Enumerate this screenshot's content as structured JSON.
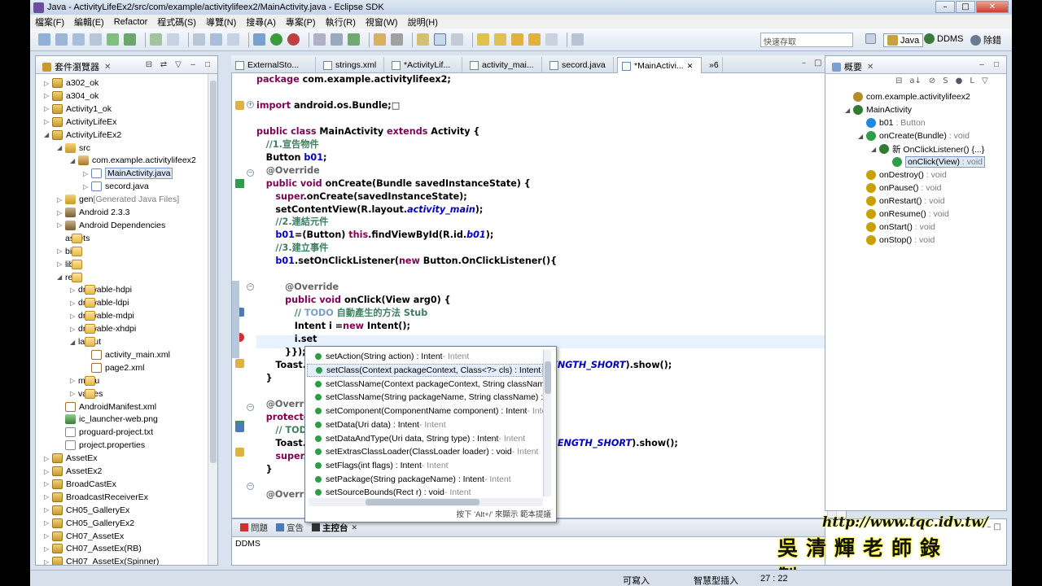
{
  "window": {
    "title": "Java - ActivityLifeEx2/src/com/example/activitylifeex2/MainActivity.java - Eclipse SDK"
  },
  "menu": [
    "檔案(F)",
    "編輯(E)",
    "Refactor",
    "程式碼(S)",
    "導覽(N)",
    "搜尋(A)",
    "專案(P)",
    "執行(R)",
    "視窗(W)",
    "說明(H)"
  ],
  "quick_access": {
    "placeholder": "快速存取"
  },
  "perspectives": {
    "java": "Java",
    "ddms": "DDMS",
    "debug": "除錯"
  },
  "explorer": {
    "title": "套件瀏覽器",
    "items": [
      {
        "label": "a302_ok",
        "depth": 0,
        "icon": "proj",
        "tw": "▷"
      },
      {
        "label": "a304_ok",
        "depth": 0,
        "icon": "proj",
        "tw": "▷"
      },
      {
        "label": "Activity1_ok",
        "depth": 0,
        "icon": "proj",
        "tw": "▷"
      },
      {
        "label": "ActivityLifeEx",
        "depth": 0,
        "icon": "proj",
        "tw": "▷"
      },
      {
        "label": "ActivityLifeEx2",
        "depth": 0,
        "icon": "proj",
        "tw": "◢"
      },
      {
        "label": "src",
        "depth": 1,
        "icon": "src",
        "tw": "◢"
      },
      {
        "label": "com.example.activitylifeex2",
        "depth": 2,
        "icon": "pkg",
        "tw": "◢"
      },
      {
        "label": "MainActivity.java",
        "depth": 3,
        "icon": "java",
        "tw": "▷",
        "selected": true
      },
      {
        "label": "secord.java",
        "depth": 3,
        "icon": "java",
        "tw": "▷"
      },
      {
        "label": "gen",
        "suffix": "[Generated Java Files]",
        "depth": 1,
        "icon": "src",
        "tw": "▷"
      },
      {
        "label": "Android 2.3.3",
        "depth": 1,
        "icon": "lib",
        "tw": "▷"
      },
      {
        "label": "Android Dependencies",
        "depth": 1,
        "icon": "lib",
        "tw": "▷"
      },
      {
        "label": "assets",
        "depth": 1,
        "icon": "fold",
        "tw": ""
      },
      {
        "label": "bin",
        "depth": 1,
        "icon": "fold",
        "tw": "▷"
      },
      {
        "label": "libs",
        "depth": 1,
        "icon": "fold",
        "tw": "▷"
      },
      {
        "label": "res",
        "depth": 1,
        "icon": "fold",
        "tw": "◢"
      },
      {
        "label": "drawable-hdpi",
        "depth": 2,
        "icon": "fold",
        "tw": "▷"
      },
      {
        "label": "drawable-ldpi",
        "depth": 2,
        "icon": "fold",
        "tw": "▷"
      },
      {
        "label": "drawable-mdpi",
        "depth": 2,
        "icon": "fold",
        "tw": "▷"
      },
      {
        "label": "drawable-xhdpi",
        "depth": 2,
        "icon": "fold",
        "tw": "▷"
      },
      {
        "label": "layout",
        "depth": 2,
        "icon": "fold",
        "tw": "◢"
      },
      {
        "label": "activity_main.xml",
        "depth": 3,
        "icon": "xml",
        "tw": ""
      },
      {
        "label": "page2.xml",
        "depth": 3,
        "icon": "xml",
        "tw": ""
      },
      {
        "label": "menu",
        "depth": 2,
        "icon": "fold",
        "tw": "▷"
      },
      {
        "label": "values",
        "depth": 2,
        "icon": "fold",
        "tw": "▷"
      },
      {
        "label": "AndroidManifest.xml",
        "depth": 1,
        "icon": "xml",
        "tw": ""
      },
      {
        "label": "ic_launcher-web.png",
        "depth": 1,
        "icon": "png",
        "tw": ""
      },
      {
        "label": "proguard-project.txt",
        "depth": 1,
        "icon": "file",
        "tw": ""
      },
      {
        "label": "project.properties",
        "depth": 1,
        "icon": "file",
        "tw": ""
      },
      {
        "label": "AssetEx",
        "depth": 0,
        "icon": "proj",
        "tw": "▷"
      },
      {
        "label": "AssetEx2",
        "depth": 0,
        "icon": "proj",
        "tw": "▷"
      },
      {
        "label": "BroadCastEx",
        "depth": 0,
        "icon": "proj",
        "tw": "▷"
      },
      {
        "label": "BroadcastReceiverEx",
        "depth": 0,
        "icon": "proj",
        "tw": "▷"
      },
      {
        "label": "CH05_GalleryEx",
        "depth": 0,
        "icon": "proj",
        "tw": "▷"
      },
      {
        "label": "CH05_GalleryEx2",
        "depth": 0,
        "icon": "proj",
        "tw": "▷"
      },
      {
        "label": "CH07_AssetEx",
        "depth": 0,
        "icon": "proj",
        "tw": "▷"
      },
      {
        "label": "CH07_AssetEx(RB)",
        "depth": 0,
        "icon": "proj",
        "tw": "▷"
      },
      {
        "label": "CH07_AssetEx(Spinner)",
        "depth": 0,
        "icon": "proj",
        "tw": "▷"
      }
    ]
  },
  "editor_tabs": [
    {
      "label": "ExternalSto..."
    },
    {
      "label": "strings.xml"
    },
    {
      "label": "*ActivityLif..."
    },
    {
      "label": "activity_mai..."
    },
    {
      "label": "secord.java"
    },
    {
      "label": "*MainActivi...",
      "active": true
    },
    {
      "label": "»6"
    }
  ],
  "code_lines": [
    {
      "html": "<span class='kw'>package</span> com.example.activitylifeex2;"
    },
    {
      "html": ""
    },
    {
      "html": "<span class='kw'>import</span> android.os.Bundle;&#x25A1;"
    },
    {
      "html": ""
    },
    {
      "html": "<span class='kw'>public class</span> MainActivity <span class='kw'>extends</span> Activity {"
    },
    {
      "html": "   <span class='cm'>//1.宣告物件</span>"
    },
    {
      "html": "   Button <span class='fi' style='font-style:normal'>b01</span>;"
    },
    {
      "html": "   <span class='an'>@Override</span>"
    },
    {
      "html": "   <span class='kw'>public void</span> onCreate(Bundle savedInstanceState) {"
    },
    {
      "html": "      <span class='kw'>super</span>.onCreate(savedInstanceState);"
    },
    {
      "html": "      setContentView(R.layout.<span class='fi'>activity_main</span>);"
    },
    {
      "html": "      <span class='cm'>//2.連結元件</span>"
    },
    {
      "html": "      <span class='fi' style='font-style:normal'>b01</span>=(Button) <span class='kw'>this</span>.findViewById(R.id.<span class='fi'>b01</span>);"
    },
    {
      "html": "      <span class='cm'>//3.建立事件</span>"
    },
    {
      "html": "      <span class='fi' style='font-style:normal'>b01</span>.setOnClickListener(<span class='kw'>new</span> Button.OnClickListener(){"
    },
    {
      "html": ""
    },
    {
      "html": "         <span class='an'>@Override</span>"
    },
    {
      "html": "         <span class='kw'>public void</span> onClick(View arg0) {"
    },
    {
      "html": "            <span class='cm'>// </span><span class='cm' style='color:#7f9fbf'>TODO</span><span class='cm'> 自動產生的方法 Stub</span>"
    },
    {
      "html": "            Intent i =<span class='kw'>new</span> Intent();"
    },
    {
      "html": "            i.set"
    },
    {
      "html": "         }});"
    },
    {
      "html": "      Toast.makeText(MainActivity.<span class='kw'>this</span>, <span style='color:#2a00ff'>\"onCreate\"</span>, Toast.<span class='fi'>LENGTH_SHORT</span>).show();"
    },
    {
      "html": "   }"
    },
    {
      "html": ""
    },
    {
      "html": "   <span class='an'>@Override</span>"
    },
    {
      "html": "   <span class='kw'>protected void</span> onDestroy() {"
    },
    {
      "html": "      <span class='cm'>// TODO 自動產生的方法 Stub</span>"
    },
    {
      "html": "      Toast.makeText(MainActivity.<span class='kw'>this</span>, <span style='color:#2a00ff'>\"onDestroy\"</span>, Toast.<span class='fi'>LENGTH_SHORT</span>).show();"
    },
    {
      "html": "      <span class='kw'>super</span>.onDestroy();"
    },
    {
      "html": "   }"
    },
    {
      "html": ""
    },
    {
      "html": "   <span class='an'>@Override</span>"
    }
  ],
  "completions": [
    {
      "sig": "setAction(String action) : Intent",
      "type": " - Intent"
    },
    {
      "sig": "setClass(Context packageContext, Class<?> cls) : Intent",
      "type": " - Intent",
      "selected": true
    },
    {
      "sig": "setClassName(Context packageContext, String className) : Intent",
      "type": " - Intent"
    },
    {
      "sig": "setClassName(String packageName, String className) : Intent",
      "type": " - Intent"
    },
    {
      "sig": "setComponent(ComponentName component) : Intent",
      "type": " - Intent"
    },
    {
      "sig": "setData(Uri data) : Intent",
      "type": " - Intent"
    },
    {
      "sig": "setDataAndType(Uri data, String type) : Intent",
      "type": " - Intent"
    },
    {
      "sig": "setExtrasClassLoader(ClassLoader loader) : void",
      "type": " - Intent"
    },
    {
      "sig": "setFlags(int flags) : Intent",
      "type": " - Intent"
    },
    {
      "sig": "setPackage(String packageName) : Intent",
      "type": " - Intent"
    },
    {
      "sig": "setSourceBounds(Rect r) : void",
      "type": " - Intent"
    }
  ],
  "completion_hint": "按下 'Alt+/' 來顯示 範本提議",
  "console": {
    "tabs": [
      "問題",
      "宣告",
      "主控台"
    ],
    "active": 2,
    "text": "DDMS"
  },
  "outline": {
    "title": "概要",
    "items": [
      {
        "label": "com.example.activitylifeex2",
        "depth": 0,
        "color": "#b58c2a"
      },
      {
        "label": "MainActivity",
        "depth": 0,
        "color": "#2e7d32",
        "tw": "◢"
      },
      {
        "label": "b01",
        "type": " : Button",
        "depth": 1,
        "color": "#1e88e5"
      },
      {
        "label": "onCreate(Bundle)",
        "type": " : void",
        "depth": 1,
        "color": "#2e9c4a",
        "tw": "◢"
      },
      {
        "label": "新 OnClickListener() {...}",
        "depth": 2,
        "color": "#2e7d32",
        "tw": "◢"
      },
      {
        "label": "onClick(View)",
        "type": " : void",
        "depth": 3,
        "color": "#2e9c4a",
        "selected": true
      },
      {
        "label": "onDestroy()",
        "type": " : void",
        "depth": 1,
        "color": "#c8a000"
      },
      {
        "label": "onPause()",
        "type": " : void",
        "depth": 1,
        "color": "#c8a000"
      },
      {
        "label": "onRestart()",
        "type": " : void",
        "depth": 1,
        "color": "#c8a000"
      },
      {
        "label": "onResume()",
        "type": " : void",
        "depth": 1,
        "color": "#c8a000"
      },
      {
        "label": "onStart()",
        "type": " : void",
        "depth": 1,
        "color": "#c8a000"
      },
      {
        "label": "onStop()",
        "type": " : void",
        "depth": 1,
        "color": "#c8a000"
      }
    ]
  },
  "watermark": {
    "url": "http://www.tqc.idv.tw/",
    "name": "吳清輝老師錄製"
  },
  "status": {
    "writable": "可寫入",
    "insert_mode": "智慧型插入",
    "position": "27 : 22"
  }
}
